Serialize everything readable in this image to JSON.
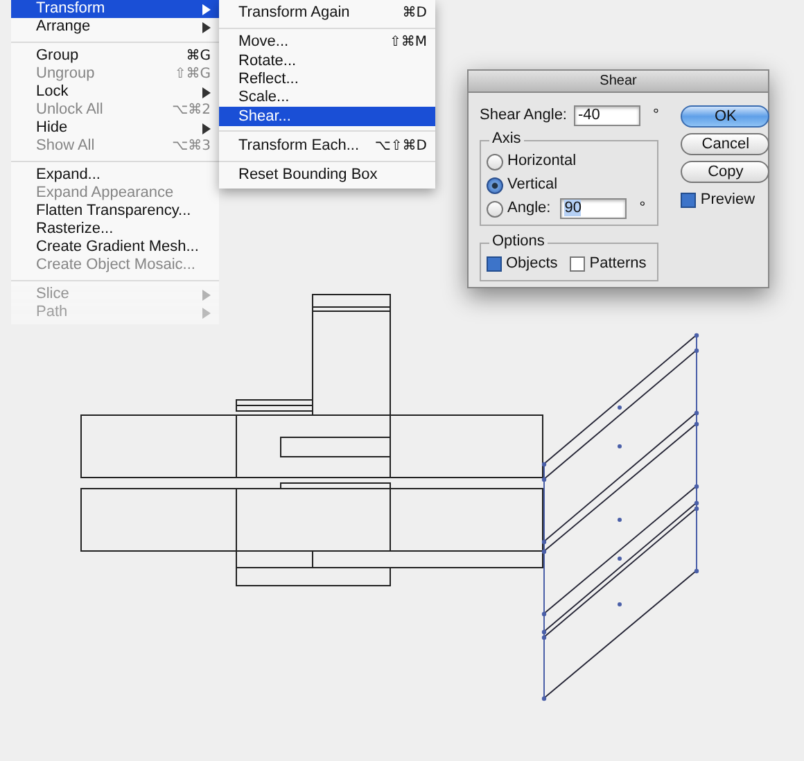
{
  "object_menu": {
    "groups": [
      [
        {
          "label": "Transform",
          "submenu": true,
          "disabled": false,
          "selected": true
        },
        {
          "label": "Arrange",
          "submenu": true,
          "disabled": false,
          "selected": false
        }
      ],
      [
        {
          "label": "Group",
          "shortcut": "⌘G",
          "submenu": false,
          "disabled": false,
          "selected": false
        },
        {
          "label": "Ungroup",
          "shortcut": "⇧⌘G",
          "submenu": false,
          "disabled": true,
          "selected": false
        },
        {
          "label": "Lock",
          "submenu": true,
          "disabled": false,
          "selected": false
        },
        {
          "label": "Unlock All",
          "shortcut": "⌥⌘2",
          "submenu": false,
          "disabled": true,
          "selected": false
        },
        {
          "label": "Hide",
          "submenu": true,
          "disabled": false,
          "selected": false
        },
        {
          "label": "Show All",
          "shortcut": "⌥⌘3",
          "submenu": false,
          "disabled": true,
          "selected": false
        }
      ],
      [
        {
          "label": "Expand...",
          "submenu": false,
          "disabled": false,
          "selected": false
        },
        {
          "label": "Expand Appearance",
          "submenu": false,
          "disabled": true,
          "selected": false
        },
        {
          "label": "Flatten Transparency...",
          "submenu": false,
          "disabled": false,
          "selected": false
        },
        {
          "label": "Rasterize...",
          "submenu": false,
          "disabled": false,
          "selected": false
        },
        {
          "label": "Create Gradient Mesh...",
          "submenu": false,
          "disabled": false,
          "selected": false
        },
        {
          "label": "Create Object Mosaic...",
          "submenu": false,
          "disabled": true,
          "selected": false
        }
      ],
      [
        {
          "label": "Slice",
          "submenu": true,
          "disabled": true,
          "selected": false
        },
        {
          "label": "Path",
          "submenu": true,
          "disabled": true,
          "selected": false
        }
      ]
    ]
  },
  "transform_submenu": {
    "groups": [
      [
        {
          "label": "Transform Again",
          "shortcut": "⌘D",
          "submenu": false,
          "disabled": false,
          "selected": false
        }
      ],
      [
        {
          "label": "Move...",
          "shortcut": "⇧⌘M",
          "submenu": false,
          "disabled": false,
          "selected": false
        },
        {
          "label": "Rotate...",
          "submenu": false,
          "disabled": false,
          "selected": false
        },
        {
          "label": "Reflect...",
          "submenu": false,
          "disabled": false,
          "selected": false
        },
        {
          "label": "Scale...",
          "submenu": false,
          "disabled": false,
          "selected": false
        },
        {
          "label": "Shear...",
          "submenu": false,
          "disabled": false,
          "selected": true
        }
      ],
      [
        {
          "label": "Transform Each...",
          "shortcut": "⌥⇧⌘D",
          "submenu": false,
          "disabled": false,
          "selected": false
        }
      ],
      [
        {
          "label": "Reset Bounding Box",
          "submenu": false,
          "disabled": false,
          "selected": false
        }
      ]
    ]
  },
  "dialog": {
    "title": "Shear",
    "shear_angle": {
      "label": "Shear Angle:",
      "value": "-40",
      "unit": "°"
    },
    "axis": {
      "legend": "Axis",
      "options": [
        {
          "label": "Horizontal",
          "selected": false
        },
        {
          "label": "Vertical",
          "selected": true
        },
        {
          "label": "Angle:",
          "selected": false,
          "value": "90",
          "unit": "°",
          "value_highlighted": true
        }
      ]
    },
    "options": {
      "legend": "Options",
      "checkboxes": [
        {
          "label": "Objects",
          "checked": true
        },
        {
          "label": "Patterns",
          "checked": false
        }
      ]
    },
    "buttons": [
      {
        "label": "OK",
        "default": true
      },
      {
        "label": "Cancel",
        "default": false
      },
      {
        "label": "Copy",
        "default": false
      }
    ],
    "preview": {
      "label": "Preview",
      "checked": true
    }
  }
}
